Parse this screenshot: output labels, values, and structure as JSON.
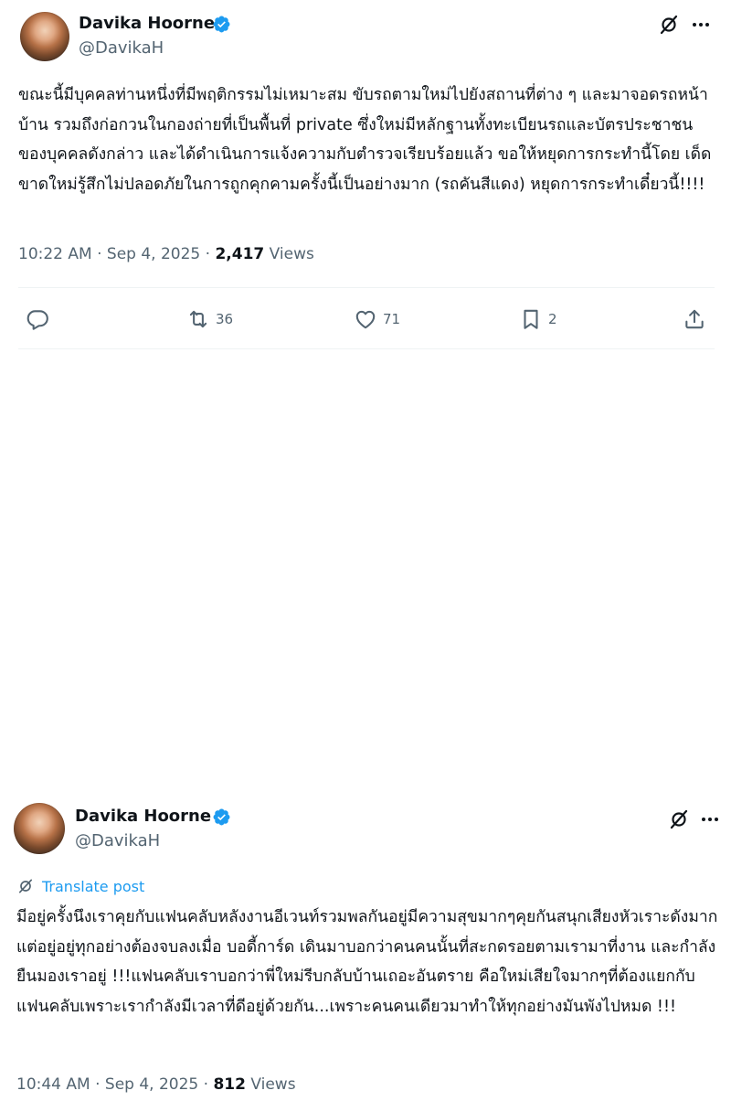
{
  "posts": [
    {
      "author": "Davika Hoorne",
      "handle": "@DavikaH",
      "text": "ขณะนี้มีบุคคลท่านหนึ่งที่มีพฤติกรรมไม่เหมาะสม ขับรถตามใหม่ไปยังสถานที่ต่าง ๆ และมาจอดรถหน้าบ้าน รวมถึงก่อกวนในกองถ่ายที่เป็นพื้นที่ private ซึ่งใหม่มีหลักฐานทั้งทะเบียนรถและบัตรประชาชนของบุคคลดังกล่าว และได้ดำเนินการแจ้งความกับตำรวจเรียบร้อยแล้ว ขอให้หยุดการกระทำนี้โดย เด็ดขาดใหม่รู้สึกไม่ปลอดภัยในการถูกคุกคามครั้งนี้เป็นอย่างมาก (รถคันสีแดง) หยุดการกระทำเดี๋ยวนี้!!!!",
      "time": "10:22 AM · Sep 4, 2025 · ",
      "views_count": "2,417",
      "views_label": " Views",
      "retweets": "36",
      "likes": "71",
      "bookmarks": "2"
    },
    {
      "author": "Davika Hoorne",
      "handle": "@DavikaH",
      "translate_label": "Translate post",
      "text": "มีอยู่ครั้งนึงเราคุยกับแฟนคลับหลังงานอีเวนท์รวมพลกันอยู่มีความสุขมากๆคุยกันสนุกเสียงหัวเราะดังมากแต่อยู่อยู่ทุกอย่างต้องจบลงเมื่อ บอดี้การ์ด เดินมาบอกว่าคนคนนั้นที่สะกดรอยตามเรามาที่งาน และกำลังยืนมองเราอยู่ !!!แฟนคลับเราบอกว่าพี่ใหม่รีบกลับบ้านเถอะอันตราย คือใหม่เสียใจมากๆที่ต้องแยกกับแฟนคลับเพราะเรากำลังมีเวลาที่ดีอยู่ด้วยกัน...เพราะคนคนเดียวมาทำให้ทุกอย่างมันพังไปหมด !!!",
      "time": "10:44 AM · Sep 4, 2025 · ",
      "views_count": "812",
      "views_label": " Views"
    }
  ],
  "icons": {
    "verified": "verified-badge-icon",
    "grok": "grok-icon",
    "more": "more-icon",
    "reply": "reply-icon",
    "retweet": "retweet-icon",
    "like": "like-icon",
    "bookmark": "bookmark-icon",
    "share": "share-icon",
    "translate": "translate-icon"
  },
  "colors": {
    "accent": "#1d9bf0",
    "muted": "#536471",
    "text": "#0f1419"
  }
}
